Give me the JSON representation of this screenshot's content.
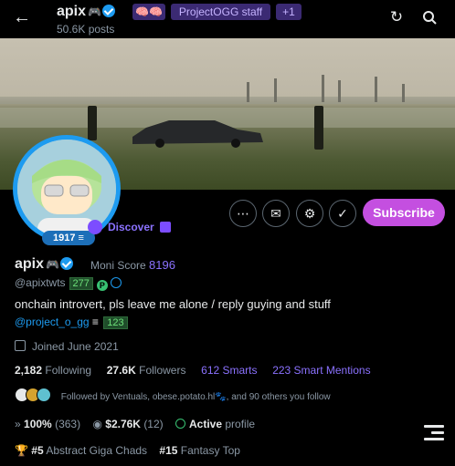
{
  "header": {
    "name": "apix",
    "name_suffix": "🎮",
    "posts": "50.6K posts",
    "tags": [
      "🧠🧠",
      "ProjectOGG staff",
      "+1"
    ]
  },
  "profile": {
    "badge_score": "1917",
    "discover_label": "Discover",
    "display_name": "apix",
    "moni_label": "Moni Score",
    "moni_value": "8196",
    "handle": "@apixtwts",
    "handle_count": "277",
    "bio": "onchain introvert, pls leave me alone / reply guying and stuff",
    "bio_link": "@project_o_gg",
    "bio_link_count": "123",
    "joined": "Joined June 2021",
    "stats": {
      "following_count": "2,182",
      "following_label": "Following",
      "followers_count": "27.6K",
      "followers_label": "Followers",
      "smarts": "612 Smarts",
      "smart_mentions": "223 Smart Mentions"
    },
    "followed_by": "Followed by Ventuals, obese.potato.hl🐾, and 90 others you follow",
    "metrics": {
      "pct": "100%",
      "pct_count": "(363)",
      "money": "$2.76K",
      "money_count": "(12)",
      "active_label": "Active",
      "active_suffix": "profile"
    },
    "ranks": {
      "r1_num": "#5",
      "r1_label": "Abstract Giga Chads",
      "r2_num": "#15",
      "r2_label": "Fantasy Top"
    }
  },
  "actions": {
    "subscribe": "Subscribe"
  },
  "colors": {
    "accent": "#c44fe0",
    "verified": "#1d9bf0",
    "purple": "#8b72ff"
  }
}
